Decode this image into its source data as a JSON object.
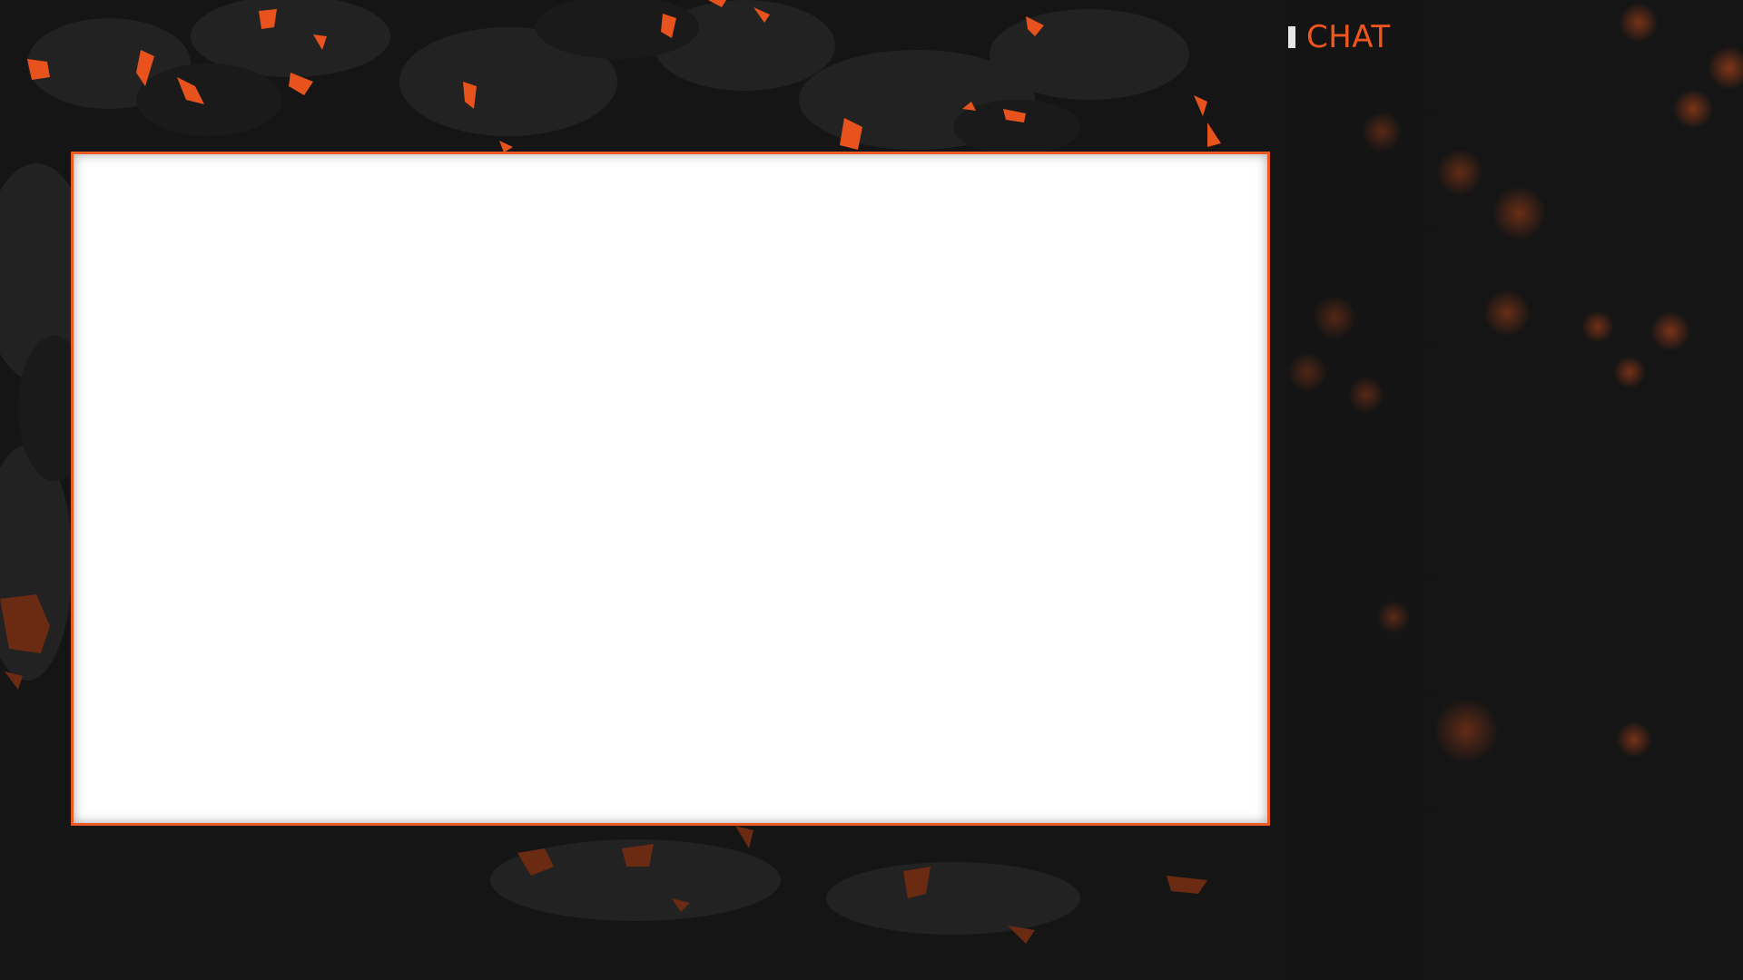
{
  "overlay": {
    "chat_title": "CHAT",
    "video_area": "",
    "colors": {
      "accent": "#f2561d",
      "frame_border": "#ea5a24",
      "background": "#151515",
      "marker": "#e6e6e6"
    }
  }
}
